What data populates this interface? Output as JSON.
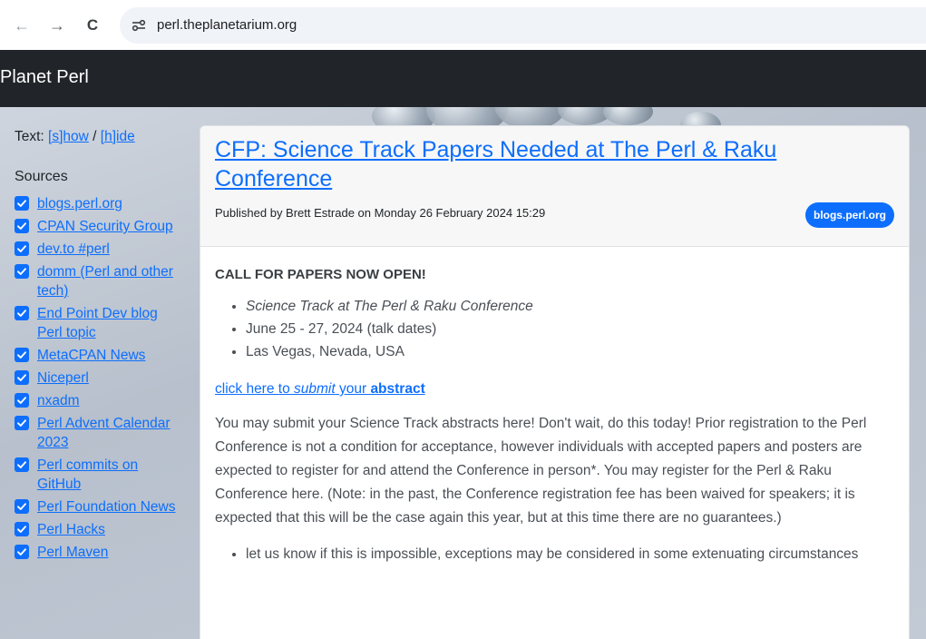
{
  "browser": {
    "url": "perl.theplanetarium.org",
    "back_glyph": "←",
    "forward_glyph": "→",
    "reload_glyph": "C"
  },
  "site": {
    "title": "Planet Perl"
  },
  "sidebar": {
    "text_toggle": {
      "prefix": "Text: ",
      "show_label": "[s]how",
      "separator": " / ",
      "hide_label": "[h]ide"
    },
    "sources_heading": "Sources",
    "sources": [
      {
        "label": "blogs.perl.org",
        "checked": true
      },
      {
        "label": "CPAN Security Group",
        "checked": true
      },
      {
        "label": "dev.to #perl",
        "checked": true
      },
      {
        "label": "domm (Perl and other tech)",
        "checked": true
      },
      {
        "label": "End Point Dev blog Perl topic",
        "checked": true
      },
      {
        "label": "MetaCPAN News",
        "checked": true
      },
      {
        "label": "Niceperl",
        "checked": true
      },
      {
        "label": "nxadm",
        "checked": true
      },
      {
        "label": "Perl Advent Calendar 2023",
        "checked": true
      },
      {
        "label": "Perl commits on GitHub",
        "checked": true
      },
      {
        "label": "Perl Foundation News",
        "checked": true
      },
      {
        "label": "Perl Hacks",
        "checked": true
      },
      {
        "label": "Perl Maven",
        "checked": true
      }
    ]
  },
  "article": {
    "title": "CFP: Science Track Papers Needed at The Perl & Raku Conference",
    "byline": "Published by Brett Estrade on Monday 26 February 2024 15:29",
    "source_badge": "blogs.perl.org",
    "heading": "CALL FOR PAPERS NOW OPEN!",
    "facts": [
      "Science Track at The Perl & Raku Conference",
      "June 25 - 27, 2024 (talk dates)",
      "Las Vegas, Nevada, USA"
    ],
    "submit_link": {
      "part1": "click here to ",
      "part2": "submit",
      "part3": " your ",
      "part4": "abstract"
    },
    "paragraph": "You may submit your Science Track abstracts here! Don't wait, do this today! Prior registration to the Perl Conference is not a condition for acceptance, however individuals with accepted papers and posters are expected to register for and attend the Conference in person*. You may register for the Perl & Raku Conference here. (Note: in the past, the Conference registration fee has been waived for speakers; it is expected that this will be the case again this year, but at this time there are no guarantees.)",
    "notes": [
      "let us know if this is impossible, exceptions may be considered in some extenuating circumstances"
    ]
  },
  "colors": {
    "accent": "#0d6efd",
    "header_bg": "#212529",
    "card_header_bg": "#f7f7f7"
  }
}
